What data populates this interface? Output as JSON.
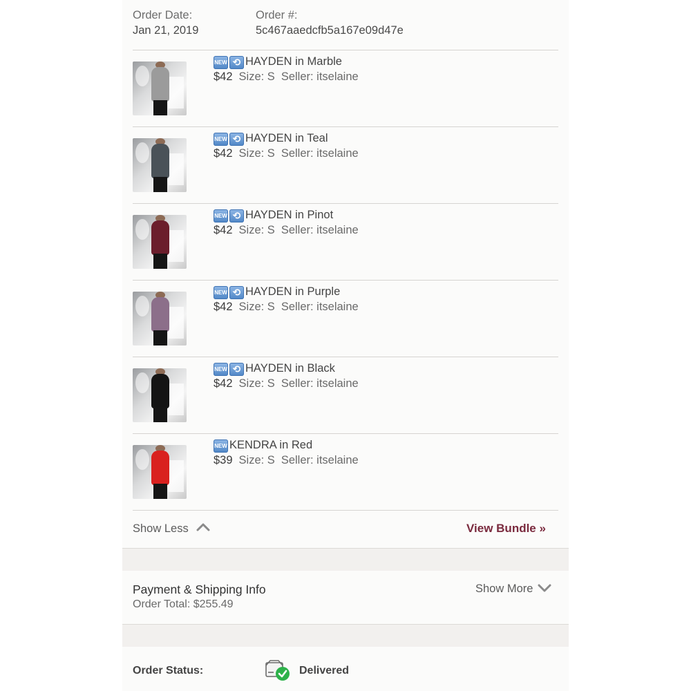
{
  "order": {
    "date_label": "Order Date:",
    "date_value": "Jan 21, 2019",
    "number_label": "Order #:",
    "number_value": "5c467aaedcfb5a167e09d47e"
  },
  "items": [
    {
      "name": "HAYDEN in Marble",
      "price": "$42",
      "size": "Size: S",
      "seller": "Seller: itselaine",
      "badges": [
        "new",
        "cycle"
      ],
      "top_color": "#9b9b9b"
    },
    {
      "name": "HAYDEN in Teal",
      "price": "$42",
      "size": "Size: S",
      "seller": "Seller: itselaine",
      "badges": [
        "new",
        "cycle"
      ],
      "top_color": "#4a5258"
    },
    {
      "name": "HAYDEN in Pinot",
      "price": "$42",
      "size": "Size: S",
      "seller": "Seller: itselaine",
      "badges": [
        "new",
        "cycle"
      ],
      "top_color": "#6b1e2c"
    },
    {
      "name": "HAYDEN in Purple",
      "price": "$42",
      "size": "Size: S",
      "seller": "Seller: itselaine",
      "badges": [
        "new",
        "cycle"
      ],
      "top_color": "#8c6f8a"
    },
    {
      "name": "HAYDEN in Black",
      "price": "$42",
      "size": "Size: S",
      "seller": "Seller: itselaine",
      "badges": [
        "new",
        "cycle"
      ],
      "top_color": "#141414"
    },
    {
      "name": "KENDRA in Red",
      "price": "$39",
      "size": "Size: S",
      "seller": "Seller: itselaine",
      "badges": [
        "new"
      ],
      "top_color": "#d9211f"
    }
  ],
  "badge_text": {
    "new": "NEW",
    "cycle": "⟲"
  },
  "actions": {
    "show_less": "Show Less",
    "view_bundle": "View Bundle »"
  },
  "payment": {
    "title": "Payment & Shipping Info",
    "total": "Order Total: $255.49",
    "show_more": "Show More"
  },
  "status": {
    "label": "Order Status:",
    "value": "Delivered",
    "icon": "delivered-box-check-icon"
  },
  "colors": {
    "accent": "#7a2a3e",
    "badge_blue": "#4f86c6",
    "delivered_green": "#2db24a"
  }
}
